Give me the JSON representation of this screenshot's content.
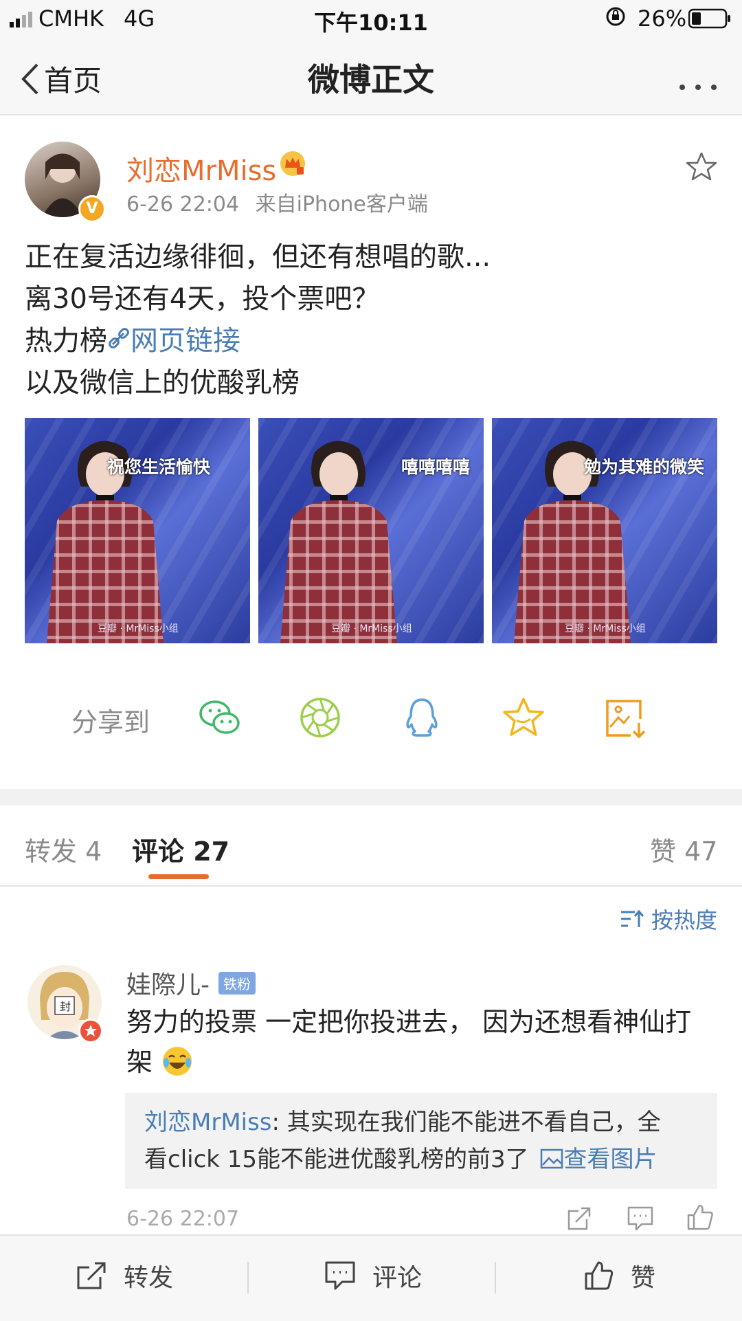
{
  "status_bar": {
    "carrier": "CMHK",
    "network": "4G",
    "time": "下午10:11",
    "battery": "26%"
  },
  "nav": {
    "back_label": "首页",
    "title": "微博正文",
    "more_label": "···"
  },
  "post": {
    "author": "刘恋MrMiss",
    "timestamp": "6-26 22:04",
    "source": "来自iPhone客户端",
    "lines": [
      "正在复活边缘徘徊，但还有想唱的歌...",
      "离30号还有4天，投个票吧？"
    ],
    "line3_prefix": "热力榜",
    "link_text": "网页链接",
    "line4": "以及微信上的优酸乳榜",
    "photos": [
      {
        "caption": "祝您生活愉快",
        "watermark": "豆瓣 · MrMiss小组"
      },
      {
        "caption": "嘻嘻嘻嘻",
        "watermark": "豆瓣 · MrMiss小组"
      },
      {
        "caption": "勉为其难的微笑",
        "watermark": "豆瓣 · MrMiss小组"
      }
    ],
    "share_label": "分享到"
  },
  "tabs": {
    "repost": "转发 4",
    "comments": "评论 27",
    "likes": "赞 47"
  },
  "sort_label": "按热度",
  "comment": {
    "user": "娃際儿-",
    "badge": "铁粉",
    "text": "努力的投票 一定把你投进去， 因为还想看神仙打架",
    "reply_author": "刘恋MrMiss",
    "reply_text_1": ": 其实现在我们能不能进不看自己，全",
    "reply_text_2": "看click 15能不能进优酸乳榜的前3了",
    "view_image": "查看图片",
    "time": "6-26 22:07"
  },
  "bottom_bar": {
    "repost": "转发",
    "comment": "评论",
    "like": "赞"
  },
  "colors": {
    "accent_orange": "#e86c2d",
    "link_blue": "#4a7db5",
    "wechat_green": "#3fb86b",
    "moments_green": "#9bcf4a",
    "qq_blue": "#5aa0dc",
    "fav_yellow": "#f3b71d",
    "save_orange": "#f39a1d"
  }
}
